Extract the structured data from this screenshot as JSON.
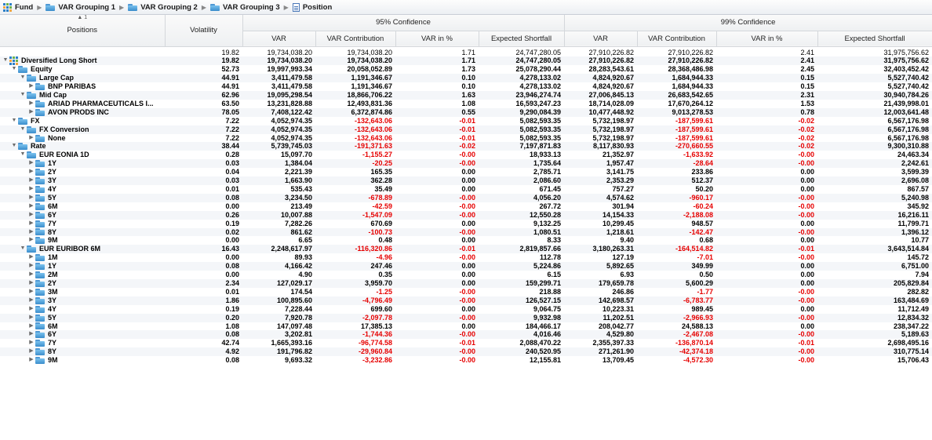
{
  "breadcrumb": [
    {
      "label": "Fund",
      "icon": "fund-icon"
    },
    {
      "label": "VAR Grouping 1",
      "icon": "folder-icon"
    },
    {
      "label": "VAR Grouping 2",
      "icon": "folder-icon"
    },
    {
      "label": "VAR Grouping 3",
      "icon": "folder-icon"
    },
    {
      "label": "Position",
      "icon": "document-icon"
    }
  ],
  "table": {
    "sort_indicator": "▲ 1",
    "col_positions": "Positions",
    "col_volatility": "Volatility",
    "group_95": "95% Confidence",
    "group_99": "99% Confidence",
    "sub_cols": [
      "VAR",
      "VAR Contribution",
      "VAR in %",
      "Expected Shortfall",
      "VAR",
      "VAR Contribution",
      "VAR in %",
      "Expected Shortfall"
    ],
    "total": [
      "19.82",
      "19,734,038.20",
      "19,734,038.20",
      "1.71",
      "24,747,280.05",
      "27,910,226.82",
      "27,910,226.82",
      "2.41",
      "31,975,756.62"
    ],
    "rows": [
      {
        "name": "Diversified Long Short",
        "level": 0,
        "toggle": "down",
        "icon": "fund",
        "v": [
          "19.82",
          "19,734,038.20",
          "19,734,038.20",
          "1.71",
          "24,747,280.05",
          "27,910,226.82",
          "27,910,226.82",
          "2.41",
          "31,975,756.62"
        ]
      },
      {
        "name": "Equity",
        "level": 1,
        "toggle": "down",
        "icon": "folder",
        "v": [
          "52.73",
          "19,997,993.34",
          "20,058,052.89",
          "1.73",
          "25,078,290.44",
          "28,283,543.61",
          "28,368,486.98",
          "2.45",
          "32,403,452.42"
        ]
      },
      {
        "name": "Large Cap",
        "level": 2,
        "toggle": "down",
        "icon": "folder",
        "v": [
          "44.91",
          "3,411,479.58",
          "1,191,346.67",
          "0.10",
          "4,278,133.02",
          "4,824,920.67",
          "1,684,944.33",
          "0.15",
          "5,527,740.42"
        ]
      },
      {
        "name": "BNP PARIBAS",
        "level": 3,
        "toggle": "right",
        "icon": "folder",
        "v": [
          "44.91",
          "3,411,479.58",
          "1,191,346.67",
          "0.10",
          "4,278,133.02",
          "4,824,920.67",
          "1,684,944.33",
          "0.15",
          "5,527,740.42"
        ]
      },
      {
        "name": "Mid Cap",
        "level": 2,
        "toggle": "down",
        "icon": "folder",
        "v": [
          "62.96",
          "19,095,298.54",
          "18,866,706.22",
          "1.63",
          "23,946,274.74",
          "27,006,845.13",
          "26,683,542.65",
          "2.31",
          "30,940,784.26"
        ]
      },
      {
        "name": "ARIAD PHARMACEUTICALS I...",
        "level": 3,
        "toggle": "right",
        "icon": "folder",
        "v": [
          "63.50",
          "13,231,828.88",
          "12,493,831.36",
          "1.08",
          "16,593,247.23",
          "18,714,028.09",
          "17,670,264.12",
          "1.53",
          "21,439,998.01"
        ]
      },
      {
        "name": "AVON PRODS INC",
        "level": 3,
        "toggle": "right",
        "icon": "folder",
        "v": [
          "78.05",
          "7,408,122.42",
          "6,372,874.86",
          "0.55",
          "9,290,084.39",
          "10,477,448.92",
          "9,013,278.53",
          "0.78",
          "12,003,641.48"
        ]
      },
      {
        "name": "FX",
        "level": 1,
        "toggle": "down",
        "icon": "folder",
        "v": [
          "7.22",
          "4,052,974.35",
          "-132,643.06",
          "-0.01",
          "5,082,593.35",
          "5,732,198.97",
          "-187,599.61",
          "-0.02",
          "6,567,176.98"
        ]
      },
      {
        "name": "FX Conversion",
        "level": 2,
        "toggle": "down",
        "icon": "folder",
        "v": [
          "7.22",
          "4,052,974.35",
          "-132,643.06",
          "-0.01",
          "5,082,593.35",
          "5,732,198.97",
          "-187,599.61",
          "-0.02",
          "6,567,176.98"
        ]
      },
      {
        "name": "None",
        "level": 3,
        "toggle": "right",
        "icon": "folder",
        "v": [
          "7.22",
          "4,052,974.35",
          "-132,643.06",
          "-0.01",
          "5,082,593.35",
          "5,732,198.97",
          "-187,599.61",
          "-0.02",
          "6,567,176.98"
        ]
      },
      {
        "name": "Rate",
        "level": 1,
        "toggle": "down",
        "icon": "folder",
        "v": [
          "38.44",
          "5,739,745.03",
          "-191,371.63",
          "-0.02",
          "7,197,871.83",
          "8,117,830.93",
          "-270,660.55",
          "-0.02",
          "9,300,310.88"
        ]
      },
      {
        "name": "EUR EONIA 1D",
        "level": 2,
        "toggle": "down",
        "icon": "folder",
        "v": [
          "0.28",
          "15,097.70",
          "-1,155.27",
          "-0.00",
          "18,933.13",
          "21,352.97",
          "-1,633.92",
          "-0.00",
          "24,463.34"
        ]
      },
      {
        "name": "1Y",
        "level": 3,
        "toggle": "right",
        "icon": "folder",
        "v": [
          "0.03",
          "1,384.04",
          "-20.25",
          "-0.00",
          "1,735.64",
          "1,957.47",
          "-28.64",
          "-0.00",
          "2,242.61"
        ]
      },
      {
        "name": "2Y",
        "level": 3,
        "toggle": "right",
        "icon": "folder",
        "v": [
          "0.04",
          "2,221.39",
          "165.35",
          "0.00",
          "2,785.71",
          "3,141.75",
          "233.86",
          "0.00",
          "3,599.39"
        ]
      },
      {
        "name": "3Y",
        "level": 3,
        "toggle": "right",
        "icon": "folder",
        "v": [
          "0.03",
          "1,663.90",
          "362.28",
          "0.00",
          "2,086.60",
          "2,353.29",
          "512.37",
          "0.00",
          "2,696.08"
        ]
      },
      {
        "name": "4Y",
        "level": 3,
        "toggle": "right",
        "icon": "folder",
        "v": [
          "0.01",
          "535.43",
          "35.49",
          "0.00",
          "671.45",
          "757.27",
          "50.20",
          "0.00",
          "867.57"
        ]
      },
      {
        "name": "5Y",
        "level": 3,
        "toggle": "right",
        "icon": "folder",
        "v": [
          "0.08",
          "3,234.50",
          "-678.89",
          "-0.00",
          "4,056.20",
          "4,574.62",
          "-960.17",
          "-0.00",
          "5,240.98"
        ]
      },
      {
        "name": "6M",
        "level": 3,
        "toggle": "right",
        "icon": "folder",
        "v": [
          "0.00",
          "213.49",
          "-42.59",
          "-0.00",
          "267.72",
          "301.94",
          "-60.24",
          "-0.00",
          "345.92"
        ]
      },
      {
        "name": "6Y",
        "level": 3,
        "toggle": "right",
        "icon": "folder",
        "v": [
          "0.26",
          "10,007.88",
          "-1,547.09",
          "-0.00",
          "12,550.28",
          "14,154.33",
          "-2,188.08",
          "-0.00",
          "16,216.11"
        ]
      },
      {
        "name": "7Y",
        "level": 3,
        "toggle": "right",
        "icon": "folder",
        "v": [
          "0.19",
          "7,282.26",
          "670.69",
          "0.00",
          "9,132.25",
          "10,299.45",
          "948.57",
          "0.00",
          "11,799.71"
        ]
      },
      {
        "name": "8Y",
        "level": 3,
        "toggle": "right",
        "icon": "folder",
        "v": [
          "0.02",
          "861.62",
          "-100.73",
          "-0.00",
          "1,080.51",
          "1,218.61",
          "-142.47",
          "-0.00",
          "1,396.12"
        ]
      },
      {
        "name": "9M",
        "level": 3,
        "toggle": "right",
        "icon": "folder",
        "v": [
          "0.00",
          "6.65",
          "0.48",
          "0.00",
          "8.33",
          "9.40",
          "0.68",
          "0.00",
          "10.77"
        ]
      },
      {
        "name": "EUR EURIBOR 6M",
        "level": 2,
        "toggle": "down",
        "icon": "folder",
        "v": [
          "16.43",
          "2,248,617.97",
          "-116,320.86",
          "-0.01",
          "2,819,857.66",
          "3,180,263.31",
          "-164,514.82",
          "-0.01",
          "3,643,514.84"
        ]
      },
      {
        "name": "1M",
        "level": 3,
        "toggle": "right",
        "icon": "folder",
        "v": [
          "0.00",
          "89.93",
          "-4.96",
          "-0.00",
          "112.78",
          "127.19",
          "-7.01",
          "-0.00",
          "145.72"
        ]
      },
      {
        "name": "1Y",
        "level": 3,
        "toggle": "right",
        "icon": "folder",
        "v": [
          "0.08",
          "4,166.42",
          "247.46",
          "0.00",
          "5,224.86",
          "5,892.65",
          "349.99",
          "0.00",
          "6,751.00"
        ]
      },
      {
        "name": "2M",
        "level": 3,
        "toggle": "right",
        "icon": "folder",
        "v": [
          "0.00",
          "4.90",
          "0.35",
          "0.00",
          "6.15",
          "6.93",
          "0.50",
          "0.00",
          "7.94"
        ]
      },
      {
        "name": "2Y",
        "level": 3,
        "toggle": "right",
        "icon": "folder",
        "v": [
          "2.34",
          "127,029.17",
          "3,959.70",
          "0.00",
          "159,299.71",
          "179,659.78",
          "5,600.29",
          "0.00",
          "205,829.84"
        ]
      },
      {
        "name": "3M",
        "level": 3,
        "toggle": "right",
        "icon": "folder",
        "v": [
          "0.01",
          "174.54",
          "-1.25",
          "-0.00",
          "218.88",
          "246.86",
          "-1.77",
          "-0.00",
          "282.82"
        ]
      },
      {
        "name": "3Y",
        "level": 3,
        "toggle": "right",
        "icon": "folder",
        "v": [
          "1.86",
          "100,895.60",
          "-4,796.49",
          "-0.00",
          "126,527.15",
          "142,698.57",
          "-6,783.77",
          "-0.00",
          "163,484.69"
        ]
      },
      {
        "name": "4Y",
        "level": 3,
        "toggle": "right",
        "icon": "folder",
        "v": [
          "0.19",
          "7,228.44",
          "699.60",
          "0.00",
          "9,064.75",
          "10,223.31",
          "989.45",
          "0.00",
          "11,712.49"
        ]
      },
      {
        "name": "5Y",
        "level": 3,
        "toggle": "right",
        "icon": "folder",
        "v": [
          "0.20",
          "7,920.78",
          "-2,097.78",
          "-0.00",
          "9,932.98",
          "11,202.51",
          "-2,966.93",
          "-0.00",
          "12,834.32"
        ]
      },
      {
        "name": "6M",
        "level": 3,
        "toggle": "right",
        "icon": "folder",
        "v": [
          "1.08",
          "147,097.48",
          "17,385.13",
          "0.00",
          "184,466.17",
          "208,042.77",
          "24,588.13",
          "0.00",
          "238,347.22"
        ]
      },
      {
        "name": "6Y",
        "level": 3,
        "toggle": "right",
        "icon": "folder",
        "v": [
          "0.08",
          "3,202.81",
          "-1,744.36",
          "-0.00",
          "4,016.46",
          "4,529.80",
          "-2,467.08",
          "-0.00",
          "5,189.63"
        ]
      },
      {
        "name": "7Y",
        "level": 3,
        "toggle": "right",
        "icon": "folder",
        "v": [
          "42.74",
          "1,665,393.16",
          "-96,774.58",
          "-0.01",
          "2,088,470.22",
          "2,355,397.33",
          "-136,870.14",
          "-0.01",
          "2,698,495.16"
        ]
      },
      {
        "name": "8Y",
        "level": 3,
        "toggle": "right",
        "icon": "folder",
        "v": [
          "4.92",
          "191,796.82",
          "-29,960.84",
          "-0.00",
          "240,520.95",
          "271,261.90",
          "-42,374.18",
          "-0.00",
          "310,775.14"
        ]
      },
      {
        "name": "9M",
        "level": 3,
        "toggle": "right",
        "icon": "folder",
        "v": [
          "0.08",
          "9,693.32",
          "-3,232.86",
          "-0.00",
          "12,155.81",
          "13,709.45",
          "-4,572.30",
          "-0.00",
          "15,706.43"
        ]
      }
    ]
  },
  "colors": {
    "negative": "#e60000",
    "folder": "#3a8ccc",
    "fund_blue": "#2d7fc7"
  }
}
